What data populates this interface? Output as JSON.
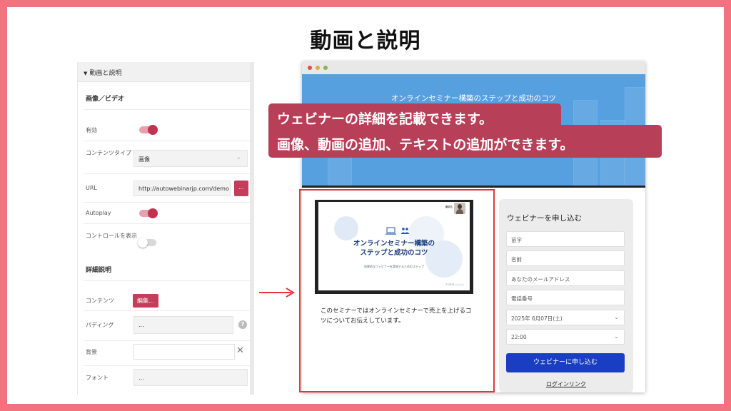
{
  "slide": {
    "title": "動画と説明"
  },
  "editor": {
    "section_title": "動画と説明",
    "media_heading": "画像／ビデオ",
    "enabled_label": "有効",
    "content_type_label": "コンテンツタイプ",
    "content_type_value": "画像",
    "url_label": "URL",
    "url_value": "http://autowebinarjp.com/demo",
    "url_button": "...",
    "autoplay_label": "Autoplay",
    "controls_label": "コントロールを表示",
    "details_heading": "詳細説明",
    "contents_label": "コンテンツ",
    "edit_button": "編集...",
    "padding_label": "パディング",
    "padding_value": "...",
    "background_label": "背景",
    "font_label": "フォント",
    "font_value": "...",
    "toggles": {
      "enabled": true,
      "autoplay": true,
      "controls": false
    }
  },
  "preview": {
    "hero_title": "オンラインセミナー構築のステップと成功のコツ",
    "thumb": {
      "title": "オンラインセミナー構築の\nステップと成功のコツ",
      "subtitle": "効果的なウェビナーを実現するためのステップ",
      "footer": "©2025 ○○○○",
      "speaker_name": "講師名"
    },
    "description": "このセミナーではオンラインセミナーで売上を上げるコツについてお伝えしています。",
    "form": {
      "heading": "ウェビナーを申し込む",
      "surname": "苗字",
      "name": "名前",
      "email": "あなたのメールアドレス",
      "phone": "電話番号",
      "date": "2025年 6月07日(土)",
      "time": "22:00",
      "submit": "ウェビナーに申し込む",
      "login": "ログインリンク"
    }
  },
  "callout": {
    "line1": "ウェビナーの詳細を記載できます。",
    "line2": "画像、動画の追加、テキストの追加ができます。"
  },
  "colors": {
    "border": "#f2737f",
    "accent": "#c43d5b",
    "hero": "#56a0e0",
    "submit": "#1a3ec1",
    "highlight": "#e8323f"
  }
}
